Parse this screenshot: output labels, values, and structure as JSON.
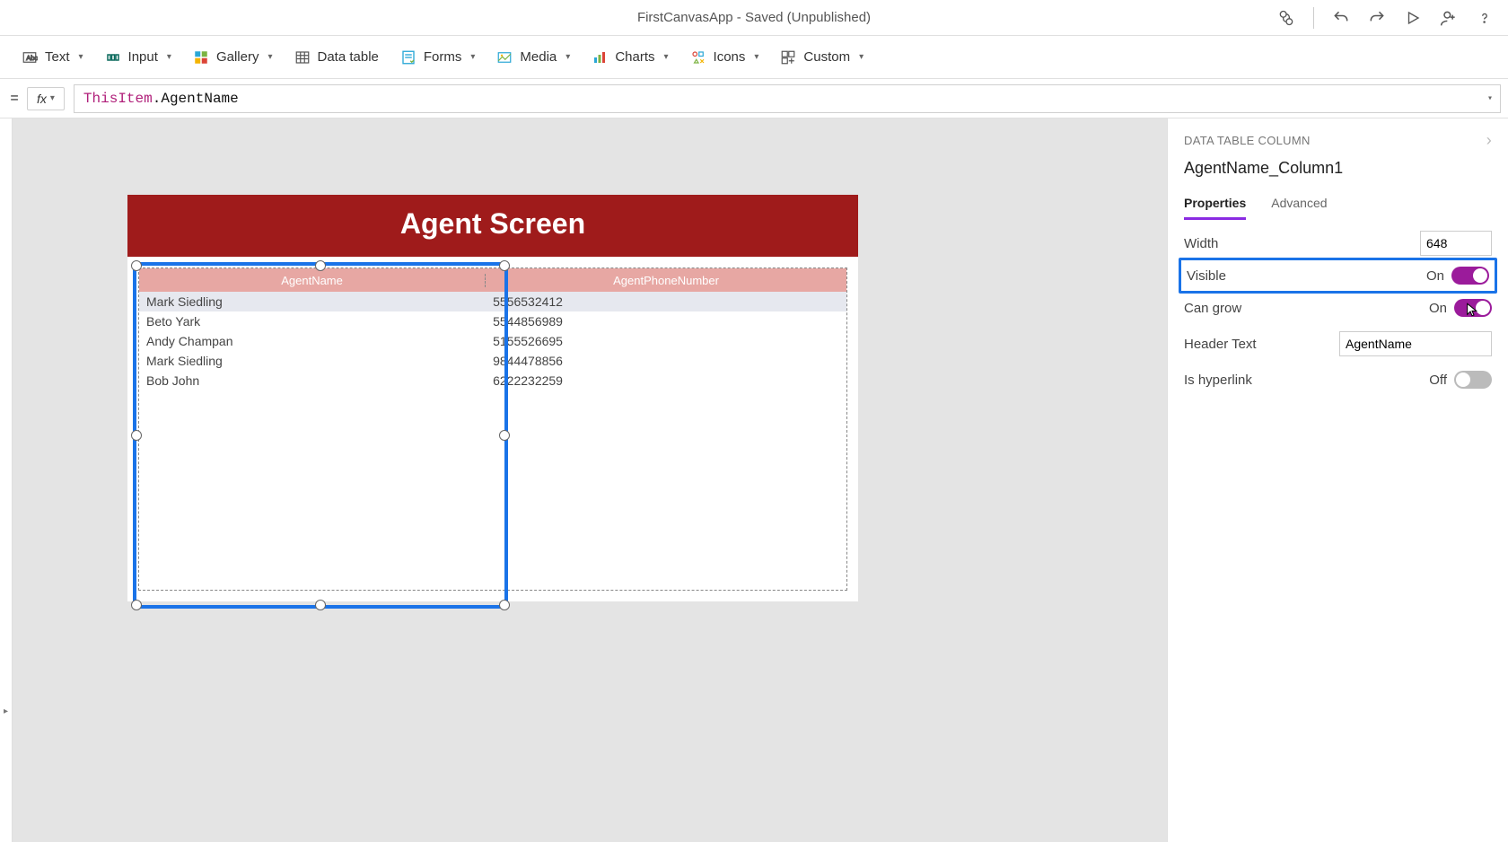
{
  "titlebar": {
    "title": "FirstCanvasApp - Saved (Unpublished)"
  },
  "ribbon": {
    "text": "Text",
    "input": "Input",
    "gallery": "Gallery",
    "datatable": "Data table",
    "forms": "Forms",
    "media": "Media",
    "charts": "Charts",
    "icons": "Icons",
    "custom": "Custom"
  },
  "formula": {
    "fx_label": "fx",
    "token_item": "ThisItem",
    "token_rest": ".AgentName"
  },
  "screen": {
    "header": "Agent Screen",
    "columns": {
      "c1": "AgentName",
      "c2": "AgentPhoneNumber"
    },
    "rows": [
      {
        "name": "Mark Siedling",
        "phone": "5556532412"
      },
      {
        "name": "Beto Yark",
        "phone": "5544856989"
      },
      {
        "name": "Andy Champan",
        "phone": "5155526695"
      },
      {
        "name": "Mark Siedling",
        "phone": "9844478856"
      },
      {
        "name": "Bob John",
        "phone": "6222232259"
      }
    ]
  },
  "panel": {
    "breadcrumb": "DATA TABLE COLUMN",
    "control_name": "AgentName_Column1",
    "tab_properties": "Properties",
    "tab_advanced": "Advanced",
    "width_label": "Width",
    "width_value": "648",
    "visible_label": "Visible",
    "visible_value": "On",
    "can_grow_label": "Can grow",
    "can_grow_value": "On",
    "header_text_label": "Header Text",
    "header_text_value": "AgentName",
    "is_hyperlink_label": "Is hyperlink",
    "is_hyperlink_value": "Off"
  }
}
